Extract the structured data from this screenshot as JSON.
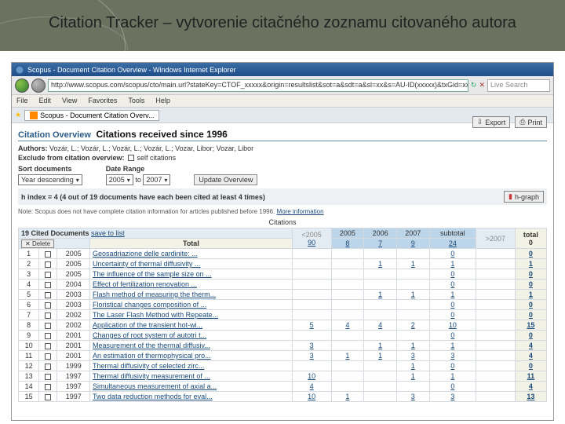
{
  "slide": {
    "title": "Citation Tracker – vytvorenie citačného zoznamu citovaného autora"
  },
  "window": {
    "title": "Scopus - Document Citation Overview - Windows Internet Explorer"
  },
  "address": "http://www.scopus.com/scopus/cto/main.url?stateKey=CTOF_xxxxx&origin=resultslist&sot=a&sdt=a&sl=xx&s=AU-ID(xxxxx)&txGid=xxxxx",
  "menu": {
    "file": "File",
    "edit": "Edit",
    "view": "View",
    "fav": "Favorites",
    "tools": "Tools",
    "help": "Help"
  },
  "tab": {
    "label": "Scopus - Document Citation Overv..."
  },
  "overview": {
    "label": "Citation Overview",
    "title": "Citations received since 1996",
    "authors_label": "Authors:",
    "authors": "Vozár, L.; Vozár, L.; Vozár, L.; Vozár, L.; Vozar, Libor; Vozar, Libor",
    "exclude_label": "Exclude from citation overview:",
    "self_label": "self citations",
    "sort_label": "Sort documents",
    "sort_value": "Year descending",
    "range_label": "Date Range",
    "range_from": "2005",
    "range_to_lab": "to",
    "range_to": "2007",
    "update_btn": "Update Overview",
    "export_btn": "Export",
    "print_btn": "Print",
    "hindex": "h index = 4 (4 out of 19 documents have each been cited at least 4 times)",
    "hgraph_btn": "h-graph",
    "note": "Note: Scopus does not have complete citation information for articles published before 1996.",
    "more_link": "More information",
    "cited_docs": "19 Cited Documents",
    "save_list": "save to list",
    "delete_btn": "Delete",
    "citations_head": "Citations",
    "cols": {
      "lt2005": "<2005",
      "y2005": "2005",
      "y2006": "2006",
      "y2007": "2007",
      "subtotal": "subtotal",
      "gt2007": ">2007",
      "total": "total"
    },
    "totals_row": {
      "label": "Total",
      "lt": "90",
      "y05": "8",
      "y06": "7",
      "y07": "9",
      "sub": "24",
      "gt": "",
      "tot": "0"
    },
    "rows": [
      {
        "n": "1",
        "y": "2005",
        "t": "Geosadriazione delle cardinite: ...",
        "lt": "",
        "y05": "",
        "y06": "",
        "y07": "",
        "sub": "0",
        "tot": "0"
      },
      {
        "n": "2",
        "y": "2005",
        "t": "Uncertainty of thermal diffusivity ...",
        "lt": "",
        "y05": "",
        "y06": "1",
        "y07": "1",
        "sub": "1",
        "tot": "1"
      },
      {
        "n": "3",
        "y": "2005",
        "t": "The influence of the sample size on ...",
        "lt": "",
        "y05": "",
        "y06": "",
        "y07": "",
        "sub": "0",
        "tot": "0"
      },
      {
        "n": "4",
        "y": "2004",
        "t": "Effect of fertilization renovation ...",
        "lt": "",
        "y05": "",
        "y06": "",
        "y07": "",
        "sub": "0",
        "tot": "0"
      },
      {
        "n": "5",
        "y": "2003",
        "t": "Flash method of measuring the therm...",
        "lt": "",
        "y05": "",
        "y06": "1",
        "y07": "1",
        "sub": "1",
        "tot": "1"
      },
      {
        "n": "6",
        "y": "2003",
        "t": "Floristical changes composition of ...",
        "lt": "",
        "y05": "",
        "y06": "",
        "y07": "",
        "sub": "0",
        "tot": "0"
      },
      {
        "n": "7",
        "y": "2002",
        "t": "The Laser Flash Method with Repeate...",
        "lt": "",
        "y05": "",
        "y06": "",
        "y07": "",
        "sub": "0",
        "tot": "0"
      },
      {
        "n": "8",
        "y": "2002",
        "t": "Application of the transient hot-wi...",
        "lt": "5",
        "y05": "4",
        "y06": "4",
        "y07": "2",
        "sub": "10",
        "tot": "15"
      },
      {
        "n": "9",
        "y": "2001",
        "t": "Changes of root system of autotri t...",
        "lt": "",
        "y05": "",
        "y06": "",
        "y07": "",
        "sub": "0",
        "tot": "0"
      },
      {
        "n": "10",
        "y": "2001",
        "t": "Measurement of the thermal diffusiv...",
        "lt": "3",
        "y05": "",
        "y06": "1",
        "y07": "1",
        "sub": "1",
        "tot": "4"
      },
      {
        "n": "11",
        "y": "2001",
        "t": "An estimation of thermophysical pro...",
        "lt": "3",
        "y05": "1",
        "y06": "1",
        "y07": "3",
        "sub": "3",
        "tot": "4"
      },
      {
        "n": "12",
        "y": "1999",
        "t": "Thermal diffusivity of selected zirc...",
        "lt": "",
        "y05": "",
        "y06": "",
        "y07": "1",
        "sub": "0",
        "tot": "0"
      },
      {
        "n": "13",
        "y": "1997",
        "t": "Thermal diffusivity measurement of ...",
        "lt": "10",
        "y05": "",
        "y06": "",
        "y07": "1",
        "sub": "1",
        "tot": "11"
      },
      {
        "n": "14",
        "y": "1997",
        "t": "Simultaneous measurement of axial a...",
        "lt": "4",
        "y05": "",
        "y06": "",
        "y07": "",
        "sub": "0",
        "tot": "4"
      },
      {
        "n": "15",
        "y": "1997",
        "t": "Two data reduction methods for eval...",
        "lt": "10",
        "y05": "1",
        "y06": "",
        "y07": "3",
        "sub": "3",
        "tot": "13"
      }
    ]
  }
}
